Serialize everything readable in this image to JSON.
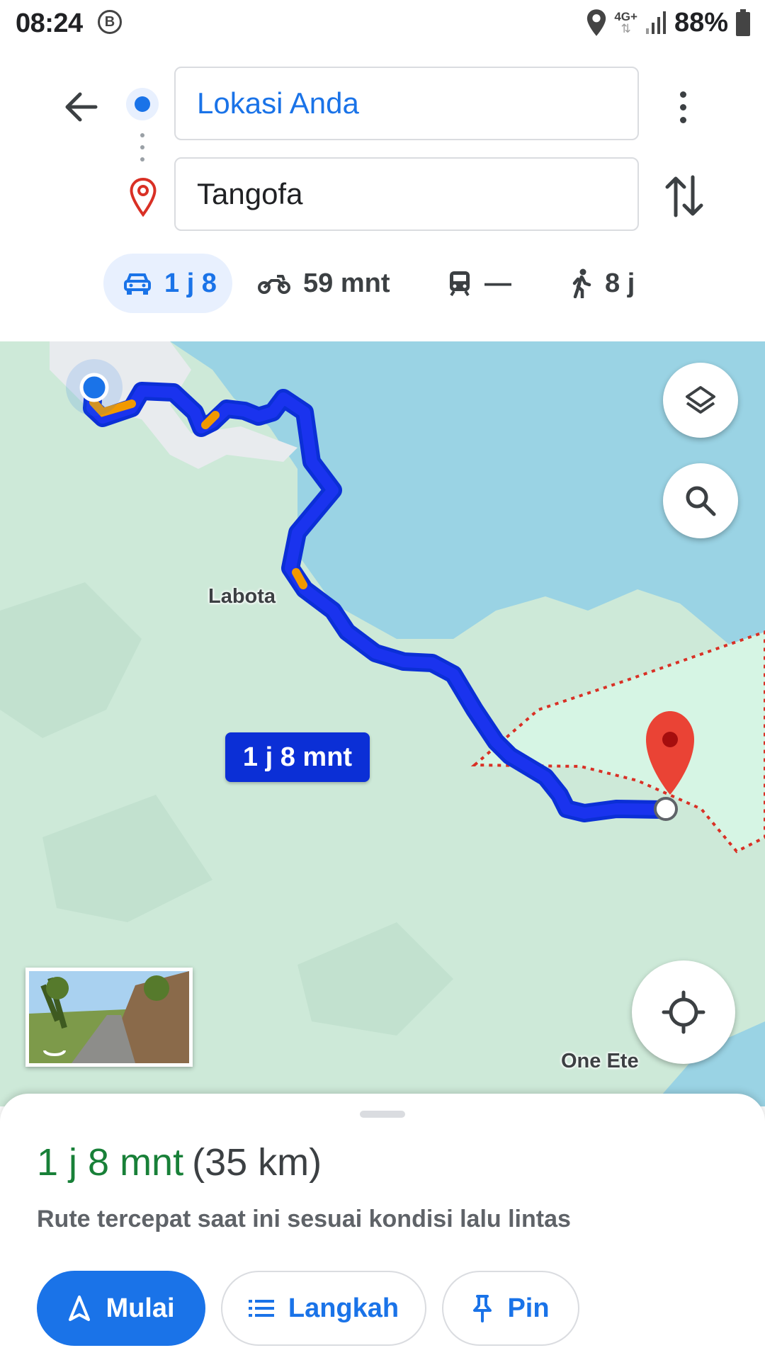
{
  "status_bar": {
    "time": "08:24",
    "notification_badge": "B",
    "network": "4G+",
    "battery": "88%",
    "icons": [
      "location-icon",
      "signal-icon",
      "battery-icon"
    ]
  },
  "directions": {
    "origin": "Lokasi Anda",
    "destination": "Tangofa",
    "modes": [
      {
        "id": "drive",
        "icon": "car-icon",
        "label": "1 j 8",
        "selected": true
      },
      {
        "id": "motorcycle",
        "icon": "motorcycle-icon",
        "label": "59 mnt",
        "selected": false
      },
      {
        "id": "transit",
        "icon": "train-icon",
        "label": "—",
        "selected": false
      },
      {
        "id": "walk",
        "icon": "walk-icon",
        "label": "8 j",
        "selected": false
      }
    ]
  },
  "map": {
    "place_labels": {
      "labota": "Labota",
      "one_ete": "One Ete"
    },
    "route_duration_label": "1 j 8 mnt",
    "colors": {
      "land": "#cde9d8",
      "water": "#9ad3e4",
      "route": "#1a33ee",
      "route_outline": "#0b2fd6",
      "traffic": "#f29900",
      "pin": "#ea4335"
    }
  },
  "sheet": {
    "time": "1 j 8 mnt",
    "distance": "(35 km)",
    "description": "Rute tercepat saat ini sesuai kondisi lalu lintas",
    "buttons": {
      "start": "Mulai",
      "steps": "Langkah",
      "pin": "Pin"
    }
  }
}
